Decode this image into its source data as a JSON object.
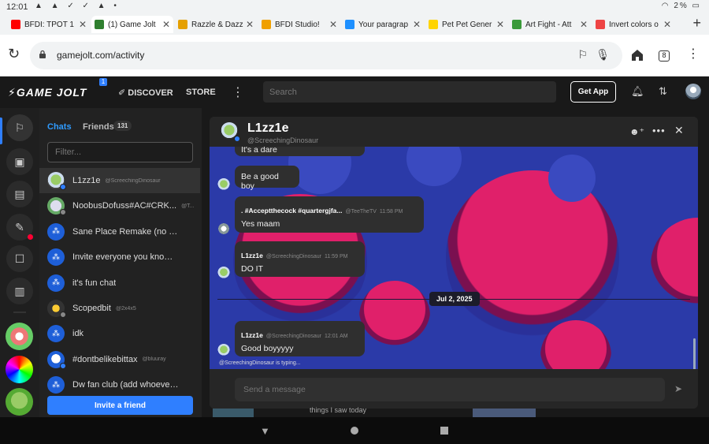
{
  "status_bar": {
    "time": "12:01",
    "battery": "2%"
  },
  "browser_tabs": [
    {
      "title": "BFDI: TPOT 1",
      "fav_color": "#ff0000"
    },
    {
      "title": "(1) Game Jolt",
      "fav_color": "#2f7f2f",
      "active": true
    },
    {
      "title": "Razzle & Dazz",
      "fav_color": "#e5a000"
    },
    {
      "title": "BFDI Studio!",
      "fav_color": "#f0a000"
    },
    {
      "title": "Your paragrap",
      "fav_color": "#1e90ff"
    },
    {
      "title": "Pet Pet Gener",
      "fav_color": "#ffd400"
    },
    {
      "title": "Art Fight - Att",
      "fav_color": "#3a9a3a"
    },
    {
      "title": "Invert colors o",
      "fav_color": "#e44"
    }
  ],
  "address_bar": {
    "url": "gamejolt.com/activity",
    "tab_count": "8"
  },
  "gj_nav": {
    "logo": "GAME JOLT",
    "logo_badge": "1",
    "discover": "DISCOVER",
    "store": "STORE",
    "search_placeholder": "Search",
    "get_app": "Get App"
  },
  "chat_sidebar": {
    "tab_chats": "Chats",
    "tab_friends": "Friends",
    "friends_count": "131",
    "filter_placeholder": "Filter...",
    "invite_button": "Invite a friend",
    "items": [
      {
        "name": "L1zz1e",
        "handle": "@ScreechingDinosaur",
        "selected": true,
        "status": "#2f7fff",
        "avatar": "lizzie"
      },
      {
        "name": "NoobusDofuss#AC#CRK...",
        "handle": "@T...",
        "status": "#888",
        "avatar": "noob"
      },
      {
        "name": "Sane Place Remake (no invitin...",
        "handle": "",
        "avatar": "group"
      },
      {
        "name": "Invite everyone you know! (#1)",
        "handle": "",
        "avatar": "group"
      },
      {
        "name": "it's fun chat",
        "handle": "",
        "avatar": "group"
      },
      {
        "name": "Scopedbit",
        "handle": "@2x4x5",
        "status": "#888",
        "avatar": "scoped"
      },
      {
        "name": "idk",
        "handle": "",
        "avatar": "group"
      },
      {
        "name": "#dontbelikebittax",
        "handle": "@bluuray",
        "status": "#2f7fff",
        "avatar": "dont"
      },
      {
        "name": "Dw fan club (add whoever you...",
        "handle": "",
        "avatar": "group"
      }
    ]
  },
  "chat": {
    "name": "L1zz1e",
    "handle": "@ScreechingDinosaur",
    "messages": [
      {
        "text": "It's a dare"
      },
      {
        "text": "Be a good boy"
      },
      {
        "author": ". #Acceptthecock #quartergjfa...",
        "handle": "@TeeTheTV",
        "time": "11:58 PM",
        "text": "Yes maam"
      },
      {
        "author": "L1zz1e",
        "handle": "@ScreechingDinosaur",
        "time": "11:59 PM",
        "text": "DO IT"
      },
      {
        "author": "L1zz1e",
        "handle": "@ScreechingDinosaur",
        "time": "12:01 AM",
        "text": "Good boyyyyy"
      }
    ],
    "date_divider": "Jul 2, 2025",
    "typing": "@ScreechingDinosaur is typing...",
    "composer_placeholder": "Send a message"
  },
  "peek": {
    "text": "things I saw today"
  },
  "colors": {
    "accent": "#2f7fff",
    "chat_bg": "#2b3aa8",
    "bubble": "#e0206a"
  }
}
